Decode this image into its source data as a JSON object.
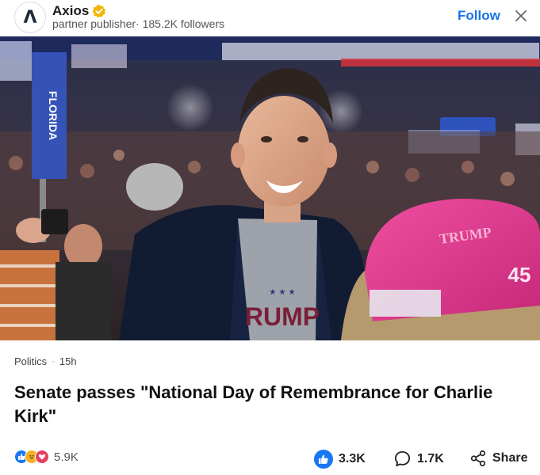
{
  "publisher": {
    "name": "Axios",
    "logo_letter": "Λ",
    "meta": "partner publisher· 185.2K followers",
    "follow_label": "Follow",
    "verified_color": "#f1b600"
  },
  "hero": {
    "banner_text": "FLORIDA",
    "shirt_text": "RUMP",
    "hat_text": "TRUMP",
    "hat_number": "45"
  },
  "article": {
    "category": "Politics",
    "separator": "·",
    "age": "15h",
    "headline": "Senate passes \"National Day of Remembrance for Charlie Kirk\""
  },
  "footer": {
    "reactions_count": "5.9K",
    "likes": "3.3K",
    "comments": "1.7K",
    "share_label": "Share"
  },
  "colors": {
    "accent": "#1a73e8",
    "like_blue": "#1877f2",
    "love_red": "#e4405f"
  }
}
